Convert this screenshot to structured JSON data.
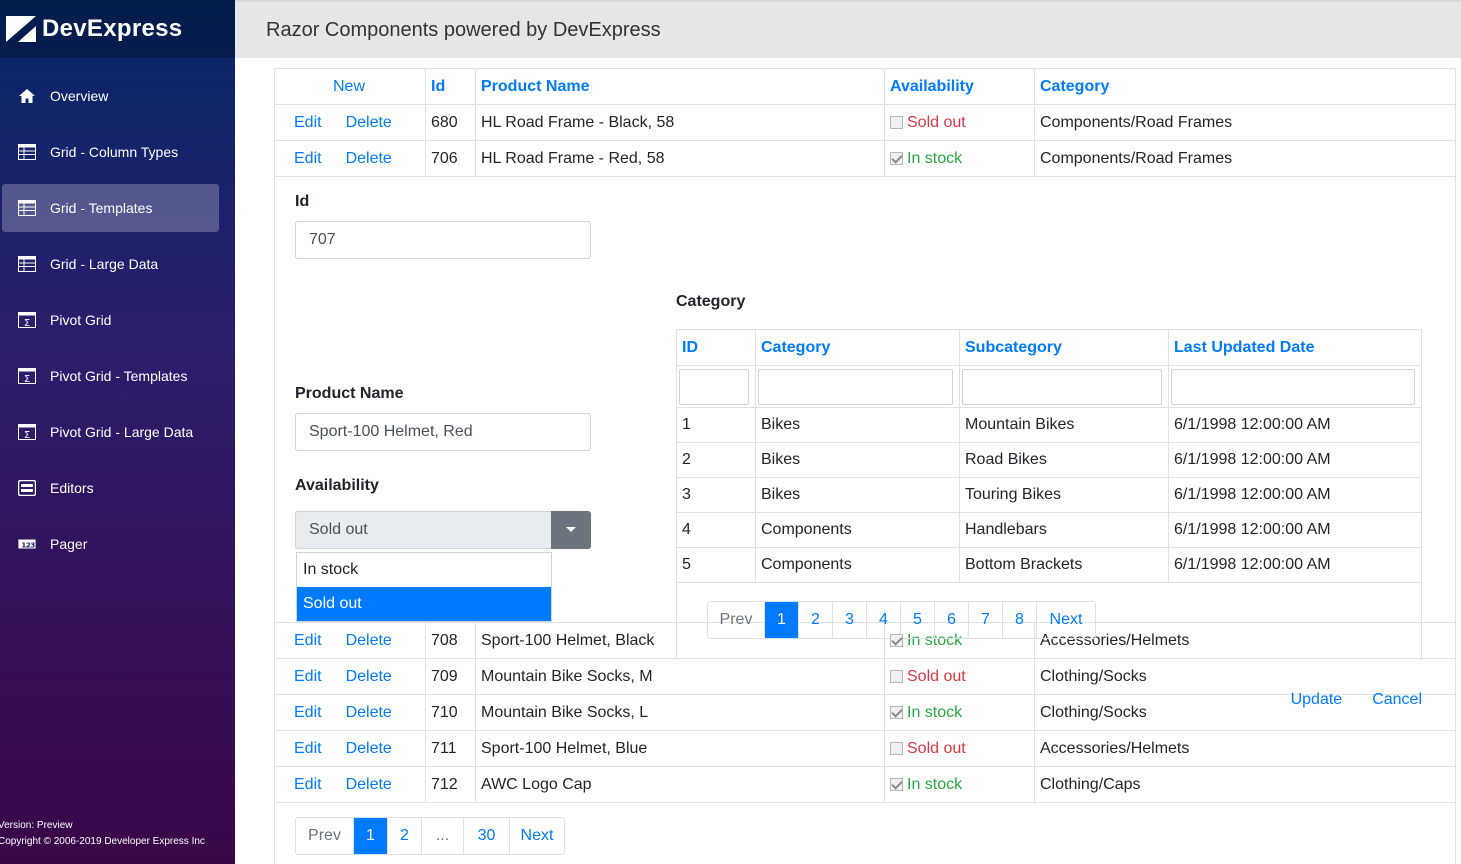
{
  "app": {
    "logo_text": "DevExpress",
    "header_title": "Razor Components powered by DevExpress",
    "version": "Version: Preview",
    "copyright": "Copyright © 2006-2019 Developer Express Inc"
  },
  "sidebar": {
    "items": [
      {
        "label": "Overview",
        "icon": "home-icon"
      },
      {
        "label": "Grid - Column Types",
        "icon": "grid-icon"
      },
      {
        "label": "Grid - Templates",
        "icon": "grid-icon",
        "active": true
      },
      {
        "label": "Grid - Large Data",
        "icon": "grid-icon"
      },
      {
        "label": "Pivot Grid",
        "icon": "pivot-icon"
      },
      {
        "label": "Pivot Grid - Templates",
        "icon": "pivot-icon"
      },
      {
        "label": "Pivot Grid - Large Data",
        "icon": "pivot-icon"
      },
      {
        "label": "Editors",
        "icon": "editors-icon"
      },
      {
        "label": "Pager",
        "icon": "pager-icon"
      }
    ]
  },
  "grid": {
    "header": {
      "new": "New",
      "id": "Id",
      "name": "Product Name",
      "availability": "Availability",
      "category": "Category"
    },
    "edit_label": "Edit",
    "delete_label": "Delete",
    "rows_top": [
      {
        "id": "680",
        "name": "HL Road Frame - Black, 58",
        "availability": "Sold out",
        "in_stock": false,
        "category": "Components/Road Frames"
      },
      {
        "id": "706",
        "name": "HL Road Frame - Red, 58",
        "availability": "In stock",
        "in_stock": true,
        "category": "Components/Road Frames"
      }
    ],
    "rows_bottom": [
      {
        "id": "708",
        "name": "Sport-100 Helmet, Black",
        "availability": "In stock",
        "in_stock": true,
        "category": "Accessories/Helmets"
      },
      {
        "id": "709",
        "name": "Mountain Bike Socks, M",
        "availability": "Sold out",
        "in_stock": false,
        "category": "Clothing/Socks"
      },
      {
        "id": "710",
        "name": "Mountain Bike Socks, L",
        "availability": "In stock",
        "in_stock": true,
        "category": "Clothing/Socks"
      },
      {
        "id": "711",
        "name": "Sport-100 Helmet, Blue",
        "availability": "Sold out",
        "in_stock": false,
        "category": "Accessories/Helmets"
      },
      {
        "id": "712",
        "name": "AWC Logo Cap",
        "availability": "In stock",
        "in_stock": true,
        "category": "Clothing/Caps"
      }
    ],
    "pager": [
      "Prev",
      "1",
      "2",
      "...",
      "30",
      "Next"
    ]
  },
  "edit_form": {
    "id_label": "Id",
    "id_value": "707",
    "name_label": "Product Name",
    "name_value": "Sport-100 Helmet, Red",
    "availability_label": "Availability",
    "availability_value": "Sold out",
    "availability_options": [
      "In stock",
      "Sold out"
    ],
    "category_label": "Category",
    "update_label": "Update",
    "cancel_label": "Cancel"
  },
  "category_grid": {
    "header": {
      "id": "ID",
      "category": "Category",
      "subcategory": "Subcategory",
      "date": "Last Updated Date"
    },
    "rows": [
      {
        "id": "1",
        "category": "Bikes",
        "subcategory": "Mountain Bikes",
        "date": "6/1/1998 12:00:00 AM"
      },
      {
        "id": "2",
        "category": "Bikes",
        "subcategory": "Road Bikes",
        "date": "6/1/1998 12:00:00 AM"
      },
      {
        "id": "3",
        "category": "Bikes",
        "subcategory": "Touring Bikes",
        "date": "6/1/1998 12:00:00 AM"
      },
      {
        "id": "4",
        "category": "Components",
        "subcategory": "Handlebars",
        "date": "6/1/1998 12:00:00 AM"
      },
      {
        "id": "5",
        "category": "Components",
        "subcategory": "Bottom Brackets",
        "date": "6/1/1998 12:00:00 AM"
      }
    ],
    "pager": [
      "Prev",
      "1",
      "2",
      "3",
      "4",
      "5",
      "6",
      "7",
      "8",
      "Next"
    ]
  },
  "colors": {
    "accent": "#007bff",
    "sold_out": "#dc3545",
    "in_stock": "#28a745",
    "dropdown_button": "#6c757d"
  }
}
